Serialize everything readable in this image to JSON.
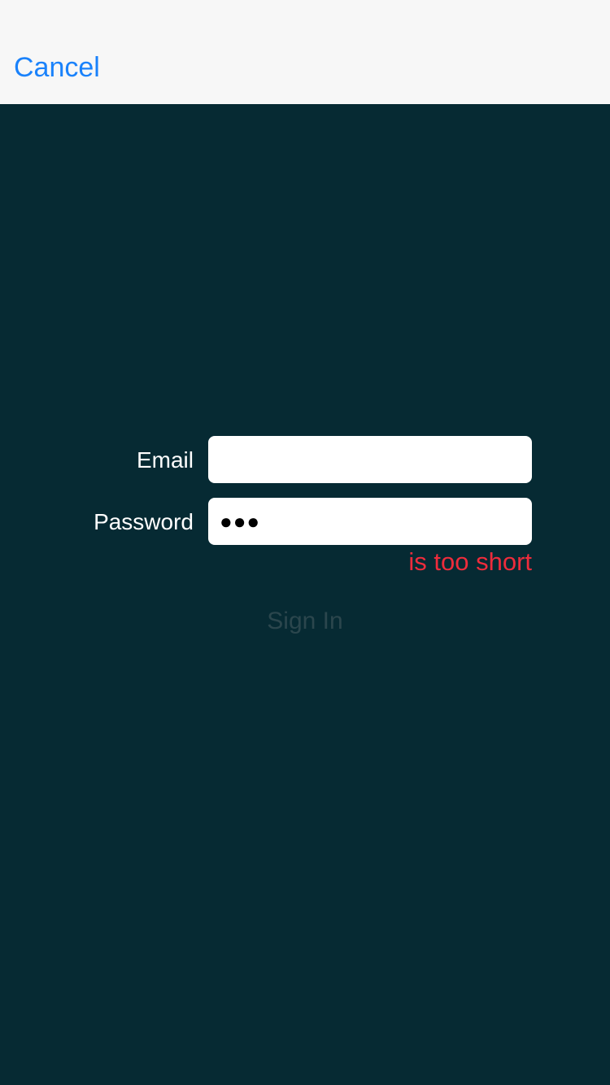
{
  "navbar": {
    "cancel_label": "Cancel"
  },
  "form": {
    "email": {
      "label": "Email",
      "value": ""
    },
    "password": {
      "label": "Password",
      "masked_value": "●●●",
      "error": "is too short"
    },
    "signin_label": "Sign In"
  },
  "colors": {
    "background": "#062a33",
    "navbar_background": "#f7f7f7",
    "accent": "#1a82fb",
    "error": "#ee2c3c",
    "disabled_text": "#2b464d"
  }
}
